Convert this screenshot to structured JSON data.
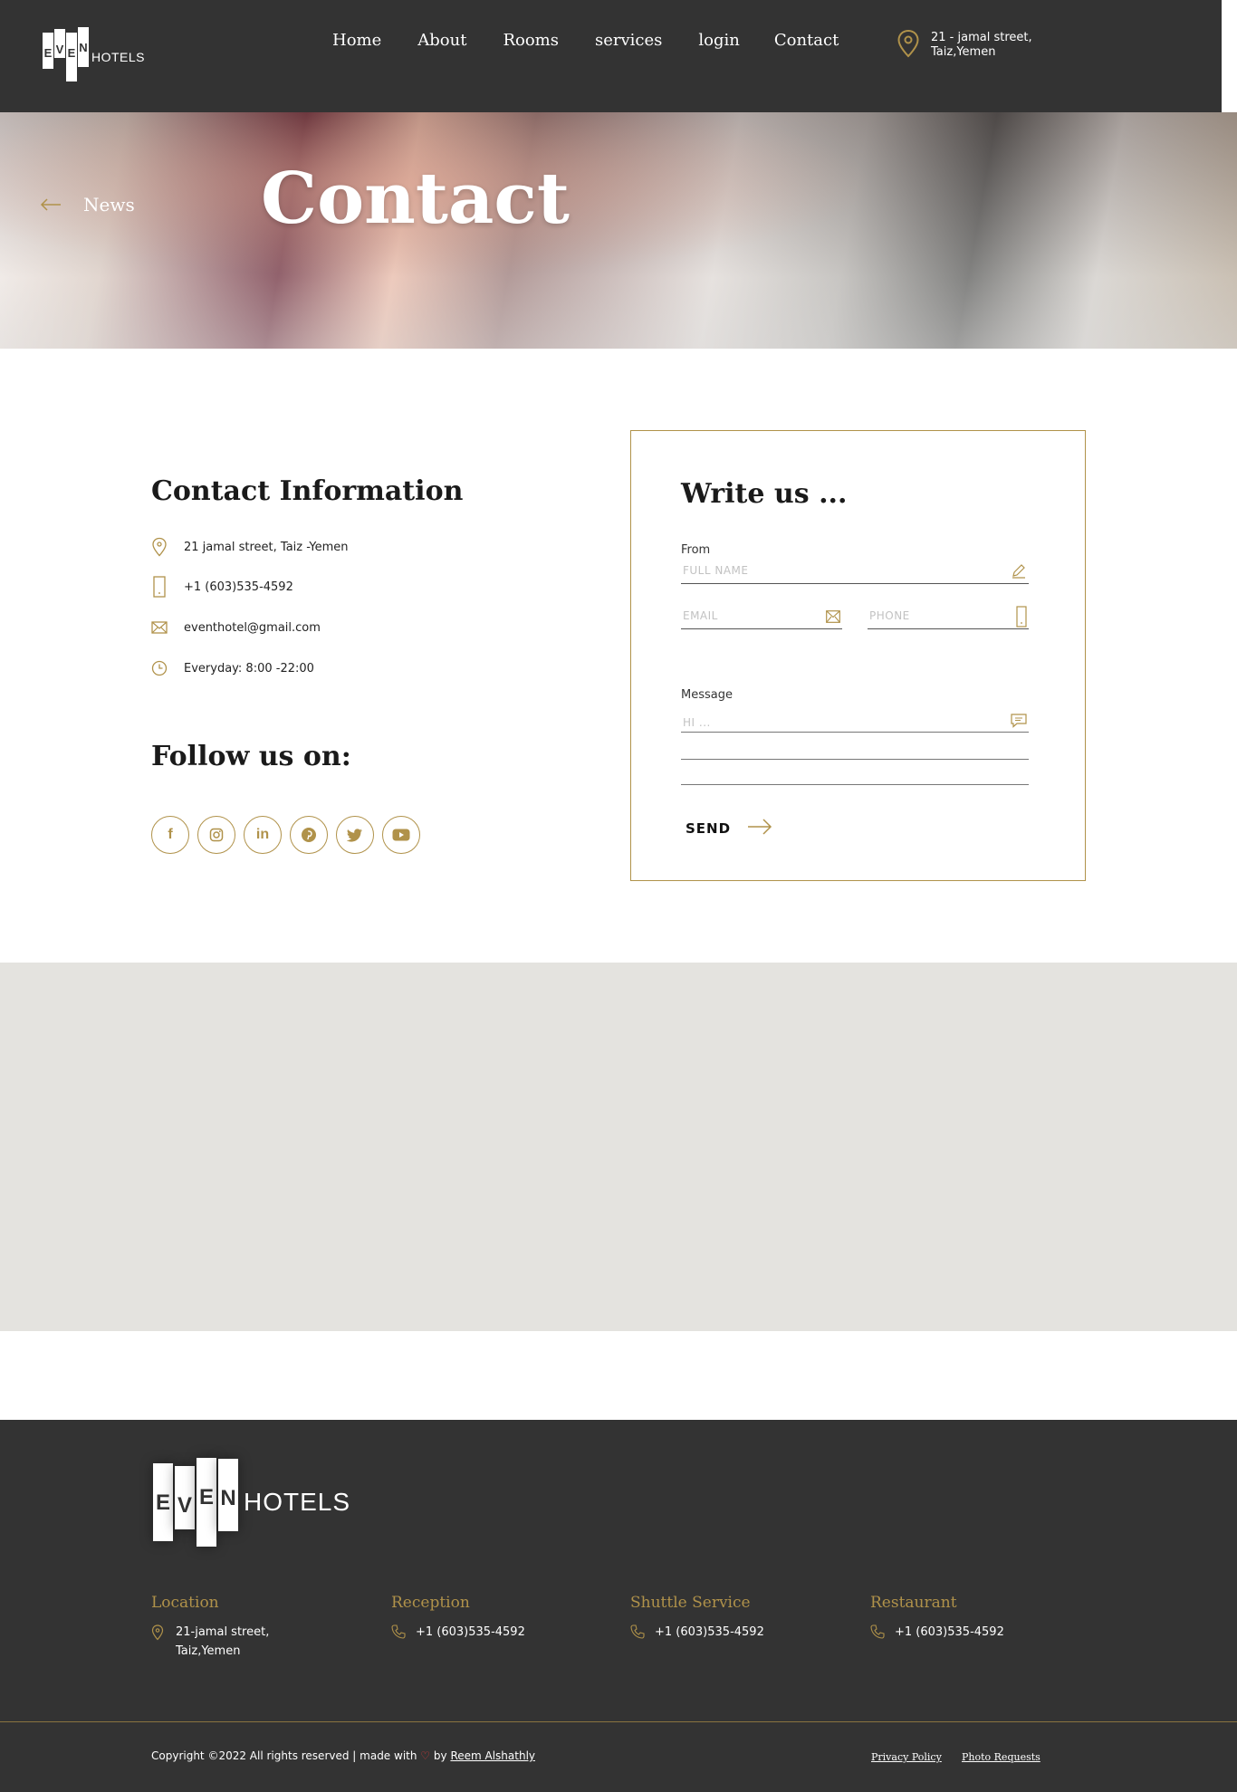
{
  "header": {
    "logo_letters": [
      "E",
      "V",
      "E",
      "N"
    ],
    "logo_text": "HOTELS",
    "nav": [
      "Home",
      "About",
      "Rooms",
      "services",
      "login",
      "Contact"
    ],
    "address_line1": "21 - jamal street,",
    "address_line2": "Taiz,Yemen",
    "address_icon": "location-pin-icon"
  },
  "hero": {
    "back_label": "News",
    "title": "Contact"
  },
  "contact_info": {
    "title": "Contact Information",
    "address": "21 jamal street, Taiz -Yemen",
    "phone": "+1 (603)535-4592",
    "email": "eventhotel@gmail.com",
    "hours": "Everyday: 8:00 -22:00"
  },
  "follow": {
    "title": "Follow us on:",
    "icons": [
      "facebook-icon",
      "instagram-icon",
      "linkedin-icon",
      "pinterest-icon",
      "twitter-icon",
      "youtube-icon"
    ]
  },
  "form": {
    "title": "Write us ...",
    "from_label": "From",
    "name_placeholder": "FULL NAME",
    "email_placeholder": "EMAIL",
    "phone_placeholder": "PHONE",
    "message_label": "Message",
    "message_placeholder": "HI ...",
    "send_label": "SEND"
  },
  "footer": {
    "logo_letters": [
      "E",
      "V",
      "E",
      "N"
    ],
    "logo_text": "HOTELS",
    "columns": [
      {
        "title": "Location",
        "line1": "21-jamal street,",
        "line2": "Taiz,Yemen"
      },
      {
        "title": "Reception",
        "line1": "+1 (603)535-4592"
      },
      {
        "title": "Shuttle Service",
        "line1": "+1 (603)535-4592"
      },
      {
        "title": "Restaurant",
        "line1": "+1 (603)535-4592"
      }
    ],
    "copyright_prefix": "Copyright ©2022 All rights reserved | made with",
    "copyright_by": "by",
    "author": "Reem Alshathly",
    "privacy": "Privacy Policy",
    "photo_requests": "Photo Requests"
  },
  "colors": {
    "accent": "#b0924a",
    "dark": "#333333",
    "map_bg": "#e4e3df"
  }
}
